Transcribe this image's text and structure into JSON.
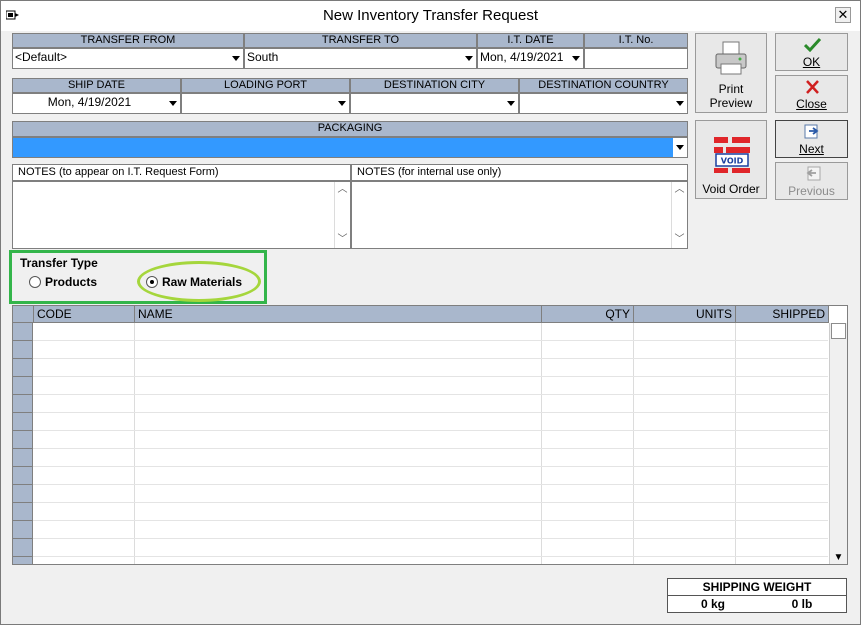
{
  "window": {
    "title": "New Inventory Transfer Request"
  },
  "header_row1": {
    "transfer_from": {
      "label": "TRANSFER FROM",
      "value": "<Default>"
    },
    "transfer_to": {
      "label": "TRANSFER TO",
      "value": "South"
    },
    "it_date": {
      "label": "I.T. DATE",
      "value": "Mon, 4/19/2021"
    },
    "it_no": {
      "label": "I.T. No.",
      "value": ""
    }
  },
  "header_row2": {
    "ship_date": {
      "label": "SHIP DATE",
      "value": "Mon, 4/19/2021"
    },
    "loading_port": {
      "label": "LOADING PORT",
      "value": ""
    },
    "destination_city": {
      "label": "DESTINATION CITY",
      "value": ""
    },
    "destination_country": {
      "label": "DESTINATION COUNTRY",
      "value": ""
    }
  },
  "packaging": {
    "label": "PACKAGING",
    "value": ""
  },
  "notes": {
    "form_label": "NOTES (to appear on I.T. Request Form)",
    "internal_label": "NOTES (for internal use only)",
    "form_value": "",
    "internal_value": ""
  },
  "buttons": {
    "print_preview": "Print Preview",
    "ok": "OK",
    "close": "Close",
    "void_order": "Void Order",
    "next": "Next",
    "previous": "Previous"
  },
  "transfer_type": {
    "legend": "Transfer Type",
    "options": [
      "Products",
      "Raw Materials"
    ],
    "selected": "Raw Materials"
  },
  "grid": {
    "columns": [
      "CODE",
      "NAME",
      "QTY",
      "UNITS",
      "SHIPPED"
    ],
    "rows": []
  },
  "shipping_weight": {
    "label": "SHIPPING WEIGHT",
    "kg": "0 kg",
    "lb": "0 lb"
  },
  "colors": {
    "accent_green": "#33b54a",
    "highlight_lime": "#a5d63c",
    "header_blue": "#a9b7cc",
    "packaging_blue": "#3399ff"
  },
  "icons": [
    "app-icon",
    "close-icon",
    "printer-icon",
    "checkmark-icon",
    "x-icon",
    "void-icon",
    "next-arrow-icon",
    "previous-arrow-icon"
  ]
}
